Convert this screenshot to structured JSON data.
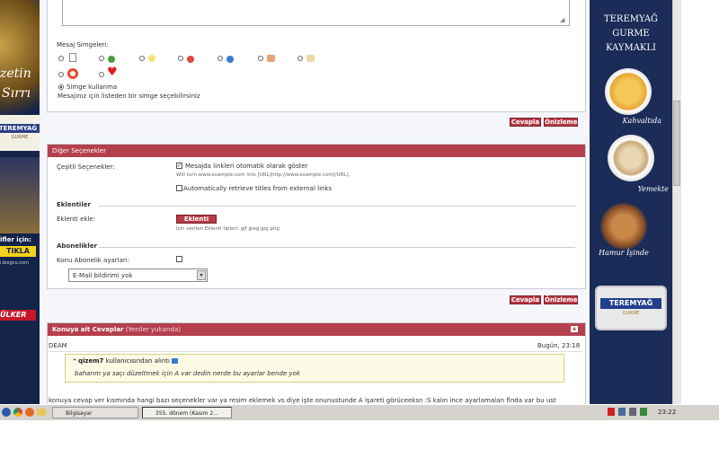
{
  "left_banner": {
    "brand_lines": [
      "zetin",
      "Sırrı"
    ],
    "logo_text": "TEREMYAĞ",
    "logo_sub": "GURME",
    "promo": "ifler için:",
    "cta": "TIKLA",
    "url": "i.blogcu.com",
    "ulker": "ÜLKER"
  },
  "right_banner": {
    "title_lines": [
      "TEREMYAĞ",
      "GURME",
      "KAYMAKLI"
    ],
    "captions": [
      "Kahvaltıda",
      "Yemekte",
      "Hamur İşinde"
    ],
    "pack_brand": "TEREMYAĞ",
    "pack_sub": "GURME"
  },
  "message_icons": {
    "title": "Mesaj Simgeleri:",
    "none_label": "Simge kullanma",
    "hint": "Mesajınız için listeden bir simge seçebilirsiniz"
  },
  "buttons": {
    "reply": "Cevapla",
    "preview": "Önizleme",
    "attach": "Eklenti ekle"
  },
  "other_options": {
    "header": "Diğer Seçenekler",
    "misc_label": "Çeşitli Seçenekler:",
    "auto_links": "Mesajda linkleri otomatik olarak göster",
    "auto_links_hint": "Will turn www.example.com into [URL]http://www.example.com[/URL].",
    "auto_titles": "Automatically retrieve titles from external links",
    "attachments_title": "Eklentiler",
    "attach_label": "Eklenti ekle:",
    "attach_hint": "İzin verilen Eklenti tipleri: gif jpeg jpg png",
    "subs_title": "Abonelikler",
    "subs_label": "Konu Abonelik ayarları:",
    "subs_value": "E-Mail bildirimi yok"
  },
  "replies": {
    "header": "Konuya ait Cevaplar",
    "header_sub": "(Yeniler yukarıda)",
    "author": "DEAM",
    "time": "Bugün, 23:18",
    "quote_user": "qizem7",
    "quote_from": "kullanıcısından alıntı",
    "quote_text": "baharım ya saçı düzeltmek için A var dedin nerde bu ayarlar bende yok",
    "body": "konuya cevap ver kısmında hangi bazı seçenekler var ya resim eklemek vs diye işte onunustunde A işareti görüceeksn :S kalın ince ayarlamaları flnda var bu ust"
  },
  "taskbar": {
    "task1": "Bilgisayar",
    "task2": "355. dönem (Kasım 2...",
    "clock": "23:22"
  },
  "colors": {
    "accent": "#b5404d",
    "banner_navy": "#13234a",
    "quote_bg": "#fdfbe6"
  }
}
